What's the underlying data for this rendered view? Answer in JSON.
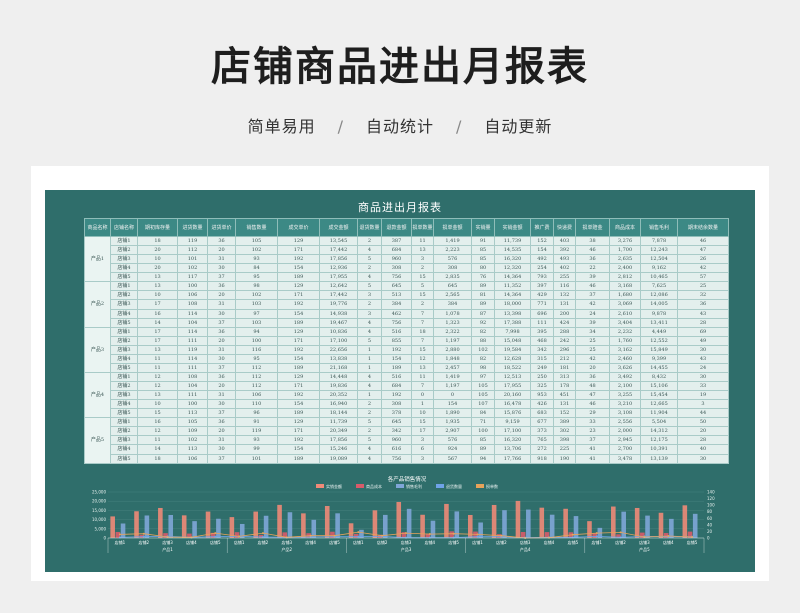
{
  "page": {
    "title": "店铺商品进出月报表",
    "tags": [
      "简单易用",
      "自动统计",
      "自动更新"
    ],
    "separator": "/"
  },
  "sheet": {
    "title": "商品进出月报表",
    "headers": [
      "商品名称",
      "店铺名称",
      "期初库存量",
      "进货数量",
      "进货单价",
      "销售数量",
      "成交单价",
      "成交金额",
      "退货数量",
      "退款金额",
      "损单数量",
      "损单金额",
      "实销量",
      "实销金额",
      "推广费",
      "快递费",
      "损单赔金",
      "商品成本",
      "销售毛利",
      "期末结余数量"
    ],
    "groups": [
      {
        "product": "产品1",
        "rows": [
          [
            "店铺1",
            "18",
            "119",
            "36",
            "105",
            "129",
            "13,545",
            "2",
            "387",
            "11",
            "1,419",
            "91",
            "11,739",
            "152",
            "403",
            "38",
            "3,276",
            "7,878",
            "46"
          ],
          [
            "店铺2",
            "20",
            "112",
            "20",
            "102",
            "171",
            "17,442",
            "4",
            "684",
            "13",
            "2,223",
            "85",
            "14,535",
            "154",
            "392",
            "46",
            "1,700",
            "12,243",
            "47"
          ],
          [
            "店铺3",
            "10",
            "101",
            "31",
            "93",
            "192",
            "17,856",
            "5",
            "960",
            "3",
            "576",
            "85",
            "16,320",
            "492",
            "493",
            "36",
            "2,635",
            "12,504",
            "26"
          ],
          [
            "店铺4",
            "20",
            "102",
            "30",
            "84",
            "154",
            "12,936",
            "2",
            "308",
            "2",
            "308",
            "80",
            "12,320",
            "254",
            "402",
            "22",
            "2,400",
            "9,162",
            "42"
          ],
          [
            "店铺5",
            "13",
            "117",
            "37",
            "95",
            "189",
            "17,955",
            "4",
            "756",
            "15",
            "2,835",
            "76",
            "14,364",
            "793",
            "255",
            "39",
            "2,812",
            "10,465",
            "57"
          ]
        ]
      },
      {
        "product": "产品2",
        "rows": [
          [
            "店铺1",
            "13",
            "100",
            "36",
            "98",
            "129",
            "12,642",
            "5",
            "645",
            "5",
            "645",
            "89",
            "11,352",
            "397",
            "116",
            "46",
            "3,168",
            "7,625",
            "25"
          ],
          [
            "店铺2",
            "10",
            "106",
            "20",
            "102",
            "171",
            "17,442",
            "3",
            "513",
            "15",
            "2,565",
            "81",
            "14,364",
            "429",
            "132",
            "37",
            "1,680",
            "12,086",
            "32"
          ],
          [
            "店铺3",
            "17",
            "108",
            "31",
            "103",
            "192",
            "19,776",
            "2",
            "384",
            "2",
            "384",
            "89",
            "18,000",
            "771",
            "131",
            "42",
            "3,069",
            "14,005",
            "36"
          ],
          [
            "店铺4",
            "16",
            "114",
            "30",
            "97",
            "154",
            "14,938",
            "3",
            "462",
            "7",
            "1,078",
            "87",
            "13,398",
            "696",
            "200",
            "24",
            "2,610",
            "9,878",
            "43"
          ],
          [
            "店铺5",
            "14",
            "104",
            "37",
            "103",
            "189",
            "19,467",
            "4",
            "756",
            "7",
            "1,323",
            "92",
            "17,388",
            "111",
            "424",
            "39",
            "3,404",
            "13,411",
            "28"
          ]
        ]
      },
      {
        "product": "产品3",
        "rows": [
          [
            "店铺1",
            "17",
            "114",
            "36",
            "94",
            "129",
            "10,836",
            "4",
            "516",
            "18",
            "2,322",
            "82",
            "7,998",
            "395",
            "288",
            "34",
            "2,232",
            "4,449",
            "69"
          ],
          [
            "店铺2",
            "17",
            "111",
            "20",
            "100",
            "171",
            "17,100",
            "5",
            "855",
            "7",
            "1,197",
            "88",
            "15,048",
            "468",
            "242",
            "25",
            "1,760",
            "12,552",
            "49"
          ],
          [
            "店铺3",
            "13",
            "119",
            "31",
            "116",
            "192",
            "22,656",
            "1",
            "192",
            "15",
            "2,880",
            "102",
            "19,584",
            "342",
            "296",
            "25",
            "3,162",
            "15,849",
            "30"
          ],
          [
            "店铺4",
            "11",
            "114",
            "30",
            "95",
            "154",
            "13,838",
            "1",
            "154",
            "12",
            "1,848",
            "82",
            "12,628",
            "315",
            "212",
            "42",
            "2,460",
            "9,399",
            "43"
          ],
          [
            "店铺5",
            "11",
            "111",
            "37",
            "112",
            "189",
            "21,168",
            "1",
            "189",
            "13",
            "2,457",
            "98",
            "18,522",
            "249",
            "181",
            "20",
            "3,626",
            "14,455",
            "24"
          ]
        ]
      },
      {
        "product": "产品4",
        "rows": [
          [
            "店铺1",
            "12",
            "108",
            "36",
            "112",
            "129",
            "14,448",
            "4",
            "516",
            "11",
            "1,419",
            "97",
            "12,513",
            "250",
            "313",
            "36",
            "3,492",
            "8,432",
            "30"
          ],
          [
            "店铺2",
            "12",
            "104",
            "20",
            "112",
            "171",
            "19,836",
            "4",
            "684",
            "7",
            "1,197",
            "105",
            "17,955",
            "325",
            "178",
            "48",
            "2,100",
            "15,106",
            "33"
          ],
          [
            "店铺3",
            "13",
            "111",
            "31",
            "106",
            "192",
            "20,352",
            "1",
            "192",
            "0",
            "0",
            "105",
            "20,160",
            "953",
            "451",
            "47",
            "3,255",
            "15,454",
            "19"
          ],
          [
            "店铺4",
            "10",
            "100",
            "30",
            "110",
            "154",
            "16,940",
            "2",
            "308",
            "1",
            "154",
            "107",
            "16,478",
            "426",
            "131",
            "46",
            "3,210",
            "12,665",
            "3"
          ],
          [
            "店铺5",
            "15",
            "113",
            "37",
            "96",
            "189",
            "18,144",
            "2",
            "378",
            "10",
            "1,890",
            "84",
            "15,876",
            "683",
            "152",
            "29",
            "3,108",
            "11,904",
            "44"
          ]
        ]
      },
      {
        "product": "产品5",
        "rows": [
          [
            "店铺1",
            "16",
            "105",
            "36",
            "91",
            "129",
            "11,739",
            "5",
            "645",
            "15",
            "1,935",
            "71",
            "9,159",
            "677",
            "389",
            "33",
            "2,556",
            "5,504",
            "50"
          ],
          [
            "店铺2",
            "12",
            "109",
            "20",
            "119",
            "171",
            "20,349",
            "2",
            "342",
            "17",
            "2,907",
            "100",
            "17,100",
            "373",
            "302",
            "23",
            "2,000",
            "14,312",
            "20"
          ],
          [
            "店铺3",
            "11",
            "102",
            "31",
            "93",
            "192",
            "17,856",
            "5",
            "960",
            "3",
            "576",
            "85",
            "16,320",
            "765",
            "398",
            "37",
            "2,945",
            "12,175",
            "28"
          ],
          [
            "店铺4",
            "14",
            "113",
            "30",
            "99",
            "154",
            "15,246",
            "4",
            "616",
            "6",
            "924",
            "89",
            "13,706",
            "272",
            "225",
            "41",
            "2,700",
            "10,391",
            "40"
          ],
          [
            "店铺5",
            "18",
            "106",
            "37",
            "101",
            "189",
            "19,089",
            "4",
            "756",
            "3",
            "567",
            "94",
            "17,766",
            "918",
            "190",
            "41",
            "3,478",
            "13,139",
            "30"
          ]
        ]
      }
    ]
  },
  "chart_data": {
    "type": "bar",
    "title": "各产品销售情况",
    "legend": [
      "实销金额",
      "商品成本",
      "销售毛利",
      "退货数量",
      "损单数"
    ],
    "colors": {
      "sales": "#f08a78",
      "cost": "#d85b6a",
      "profit": "#7fa6d8",
      "returns": "#6fa3e8",
      "damage": "#e8a35a"
    },
    "ylim_left": [
      0,
      25000
    ],
    "yticks_left": [
      "25,000",
      "20,000",
      "15,000",
      "10,000",
      "5,000",
      "0"
    ],
    "ylim_right": [
      0,
      140
    ],
    "yticks_right": [
      "140",
      "120",
      "100",
      "80",
      "60",
      "40",
      "20",
      "0"
    ],
    "stores": [
      "店铺1",
      "店铺2",
      "店铺3",
      "店铺4",
      "店铺5"
    ],
    "products": [
      "产品1",
      "产品2",
      "产品3",
      "产品4",
      "产品5"
    ],
    "series": [
      {
        "name": "实销金额",
        "values": [
          11739,
          14535,
          16320,
          12320,
          14364,
          11352,
          14364,
          18000,
          13398,
          17388,
          7998,
          15048,
          19584,
          12628,
          18522,
          12513,
          17955,
          20160,
          16478,
          15876,
          9159,
          17100,
          16320,
          13706,
          17766
        ]
      },
      {
        "name": "商品成本",
        "values": [
          3276,
          1700,
          2635,
          2400,
          2812,
          3168,
          1680,
          3069,
          2610,
          3404,
          2232,
          1760,
          3162,
          2460,
          3626,
          3492,
          2100,
          3255,
          3210,
          3108,
          2556,
          2000,
          2945,
          2700,
          3478
        ]
      },
      {
        "name": "销售毛利",
        "values": [
          7878,
          12243,
          12504,
          9162,
          10465,
          7625,
          12086,
          14005,
          9878,
          13411,
          4449,
          12552,
          15849,
          9399,
          14455,
          8432,
          15106,
          15454,
          12665,
          11904,
          5504,
          14312,
          12175,
          10391,
          13139
        ]
      },
      {
        "name": "退货数量",
        "values": [
          2,
          4,
          5,
          2,
          4,
          5,
          3,
          2,
          3,
          4,
          4,
          5,
          1,
          1,
          1,
          4,
          4,
          1,
          2,
          2,
          5,
          2,
          5,
          4,
          4
        ]
      },
      {
        "name": "损单数",
        "values": [
          11,
          13,
          3,
          2,
          15,
          5,
          15,
          2,
          7,
          7,
          18,
          7,
          15,
          12,
          13,
          11,
          7,
          0,
          1,
          10,
          15,
          17,
          3,
          6,
          3
        ]
      }
    ]
  }
}
